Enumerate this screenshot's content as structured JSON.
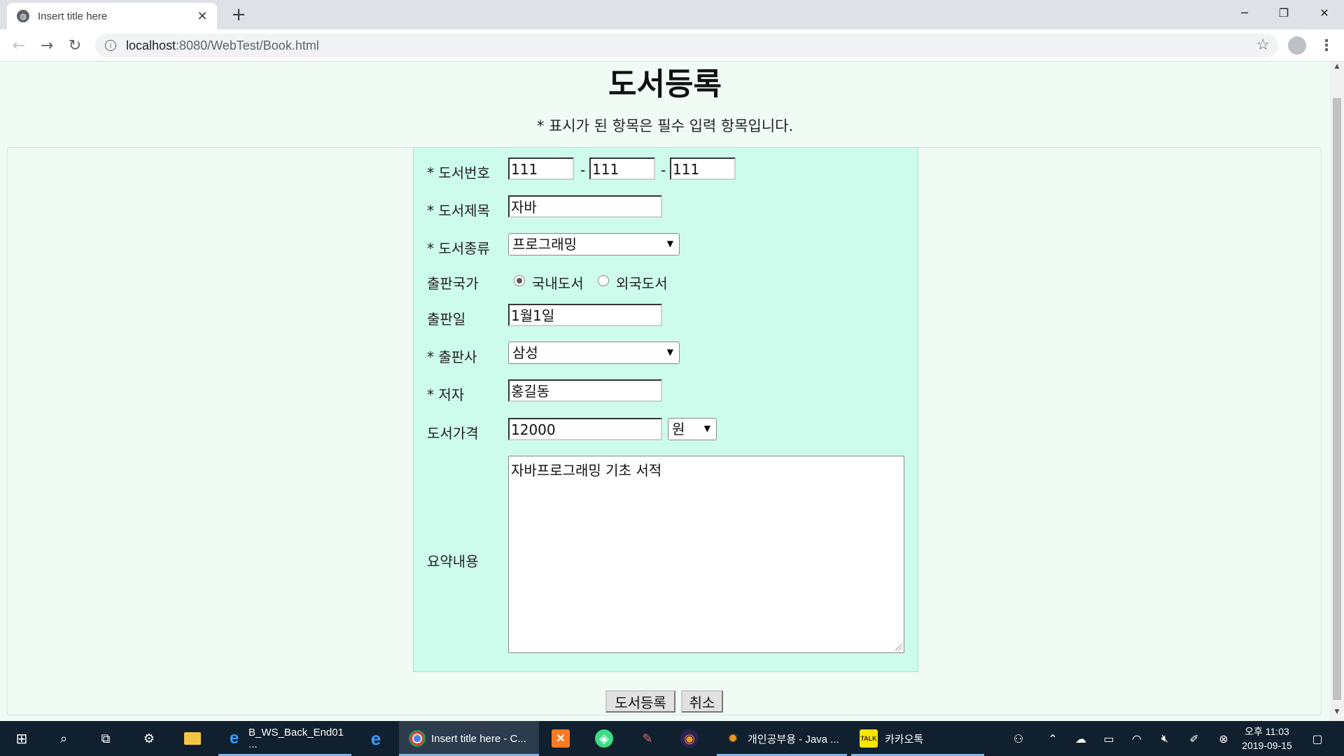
{
  "browser": {
    "tab_title": "Insert title here",
    "tab_close": "✕",
    "new_tab": "+",
    "url_host": "localhost",
    "url_rest": ":8080/WebTest/Book.html",
    "win_min": "─",
    "win_max": "❐",
    "win_close": "✕"
  },
  "page": {
    "title": "도서등록",
    "notice": "* 표시가 된 항목은 필수 입력 항목입니다.",
    "fields": {
      "book_no_label": "* 도서번호",
      "book_no_1": "111",
      "book_no_sep1": "-",
      "book_no_2": "111",
      "book_no_sep2": "-",
      "book_no_3": "111",
      "title_label": "* 도서제목",
      "title_value": "자바",
      "genre_label": "* 도서종류",
      "genre_value": "프로그래밍",
      "country_label": "출판국가",
      "country_domestic": "국내도서",
      "country_foreign": "외국도서",
      "date_label": "출판일",
      "date_value": "1월1일",
      "publisher_label": "* 출판사",
      "publisher_value": "삼성",
      "author_label": "* 저자",
      "author_value": "홍길동",
      "price_label": "도서가격",
      "price_value": "12000",
      "currency_value": "원",
      "summary_label": "요약내용",
      "summary_value": "자바프로그래밍 기초 서적"
    },
    "buttons": {
      "submit": "도서등록",
      "cancel": "취소"
    }
  },
  "taskbar": {
    "items": [
      {
        "label": "B_WS_Back_End01 ..."
      },
      {
        "label": "Insert title here - C..."
      },
      {
        "label": "개인공부용 - Java ..."
      },
      {
        "label": "카카오톡"
      }
    ],
    "clock_time": "오후 11:03",
    "clock_date": "2019-09-15"
  }
}
